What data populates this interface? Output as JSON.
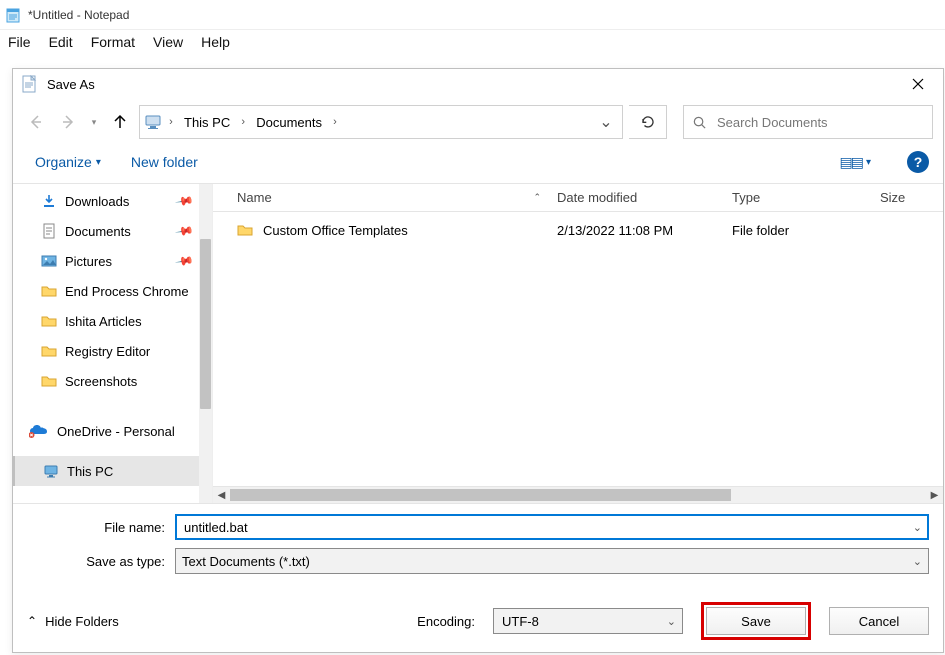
{
  "notepad": {
    "title": "*Untitled - Notepad",
    "menu": [
      "File",
      "Edit",
      "Format",
      "View",
      "Help"
    ]
  },
  "dialog": {
    "title": "Save As",
    "breadcrumb": {
      "seg1": "This PC",
      "seg2": "Documents"
    },
    "search_placeholder": "Search Documents",
    "organize": "Organize",
    "new_folder": "New folder",
    "columns": {
      "name": "Name",
      "date": "Date modified",
      "type": "Type",
      "size": "Size"
    },
    "tree": {
      "downloads": "Downloads",
      "documents": "Documents",
      "pictures": "Pictures",
      "epc": "End Process Chrome",
      "ishita": "Ishita Articles",
      "regedit": "Registry Editor",
      "screenshots": "Screenshots",
      "onedrive": "OneDrive - Personal",
      "thispc": "This PC"
    },
    "rows": [
      {
        "name": "Custom Office Templates",
        "date": "2/13/2022 11:08 PM",
        "type": "File folder",
        "size": ""
      }
    ],
    "filename_label": "File name:",
    "filename_value": "untitled.bat",
    "saveastype_label": "Save as type:",
    "saveastype_value": "Text Documents (*.txt)",
    "hide_folders": "Hide Folders",
    "encoding_label": "Encoding:",
    "encoding_value": "UTF-8",
    "save": "Save",
    "cancel": "Cancel"
  }
}
